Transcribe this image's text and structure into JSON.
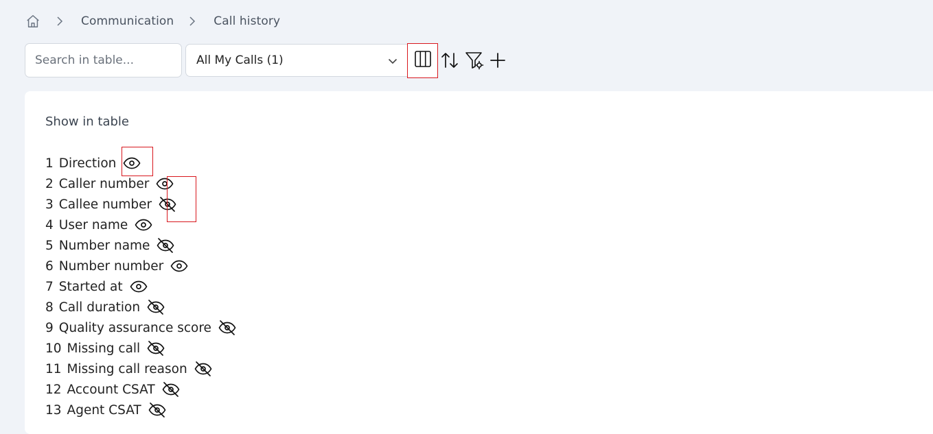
{
  "breadcrumb": {
    "home_icon": "home-icon",
    "items": [
      "Communication",
      "Call history"
    ]
  },
  "toolbar": {
    "search_placeholder": "Search in table...",
    "view_select_value": "All My Calls (1)",
    "icons": [
      "columns-icon",
      "sort-icon",
      "filter-settings-icon",
      "plus-icon"
    ]
  },
  "panel": {
    "title": "Show in table",
    "columns": [
      {
        "num": "1",
        "name": "Direction",
        "visible": true
      },
      {
        "num": "2",
        "name": "Caller number",
        "visible": true
      },
      {
        "num": "3",
        "name": "Callee number",
        "visible": false
      },
      {
        "num": "4",
        "name": "User name",
        "visible": true
      },
      {
        "num": "5",
        "name": "Number name",
        "visible": false
      },
      {
        "num": "6",
        "name": "Number number",
        "visible": true
      },
      {
        "num": "7",
        "name": "Started at",
        "visible": true
      },
      {
        "num": "8",
        "name": "Call duration",
        "visible": false
      },
      {
        "num": "9",
        "name": "Quality assurance score",
        "visible": false
      },
      {
        "num": "10",
        "name": "Missing call",
        "visible": false
      },
      {
        "num": "11",
        "name": "Missing call reason",
        "visible": false
      },
      {
        "num": "12",
        "name": "Account CSAT",
        "visible": false
      },
      {
        "num": "13",
        "name": "Agent CSAT",
        "visible": false
      }
    ]
  },
  "colors": {
    "background": "#f0f3f8",
    "panel": "#ffffff",
    "highlight": "#d8161c",
    "text": "#222222",
    "muted": "#4a5360"
  }
}
